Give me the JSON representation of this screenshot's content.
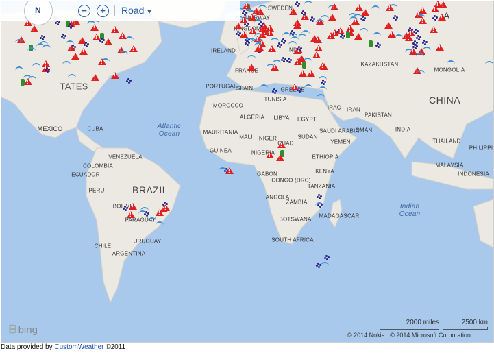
{
  "toolbar": {
    "compass_label": "N",
    "zoom_out_symbol": "−",
    "zoom_in_symbol": "+",
    "map_style": "Road"
  },
  "labels": {
    "countries_big": [
      "BRAZIL",
      "CHINA"
    ],
    "countries": [
      "SWEDEN",
      "NORWAY",
      "KINGDOM",
      "IRELAND",
      "FRANCE",
      "SPAIN",
      "PORTUGAL",
      "GREECE",
      "TUNISIA",
      "MOROCCO",
      "ALGERIA",
      "LIBYA",
      "EGYPT",
      "MAURITANIA",
      "MALI",
      "NIGER",
      "CHAD",
      "SUDAN",
      "GUINEA",
      "NIGERIA",
      "ETHIOPIA",
      "GABON",
      "CONGO (DRC)",
      "KENYA",
      "TANZANIA",
      "ANGOLA",
      "ZAMBIA",
      "BOTSWANA",
      "MADAGASCAR",
      "SOUTH AFRICA",
      "IRAQ",
      "IRAN",
      "PAKISTAN",
      "SAUDI ARABIA",
      "OMAN",
      "YEMEN",
      "INDIA",
      "THAILAND",
      "MALAYSIA",
      "INDONESIA",
      "PHILIPPIN",
      "KAZAKHSTAN",
      "MONGOLIA",
      "MEXICO",
      "CUBA",
      "VENEZUELA",
      "COLOMBIA",
      "ECUADOR",
      "PERU",
      "BOLIVIA",
      "CHILE",
      "ARGENTINA",
      "URUGUAY",
      "PARAGUAY",
      "TATES",
      "ND",
      "A"
    ],
    "oceans": [
      "Atlantic Ocean",
      "Indian Ocean"
    ]
  },
  "attribution": {
    "logo": "bing",
    "scale_miles": "2000 miles",
    "scale_km": "2500 km",
    "copyright_nokia": "© 2014 Nokia",
    "copyright_ms": "© 2014 Microsoft Corporation"
  },
  "footer": {
    "prefix": "Data provided by",
    "link": "CustomWeather",
    "suffix": "©2011"
  },
  "colors": {
    "ocean": "#a8c8ec",
    "land": "#ece9e2",
    "warning": "#e02020",
    "wave": "#3a8fd9",
    "rain": "#27268d",
    "link": "#1a4dbb"
  }
}
